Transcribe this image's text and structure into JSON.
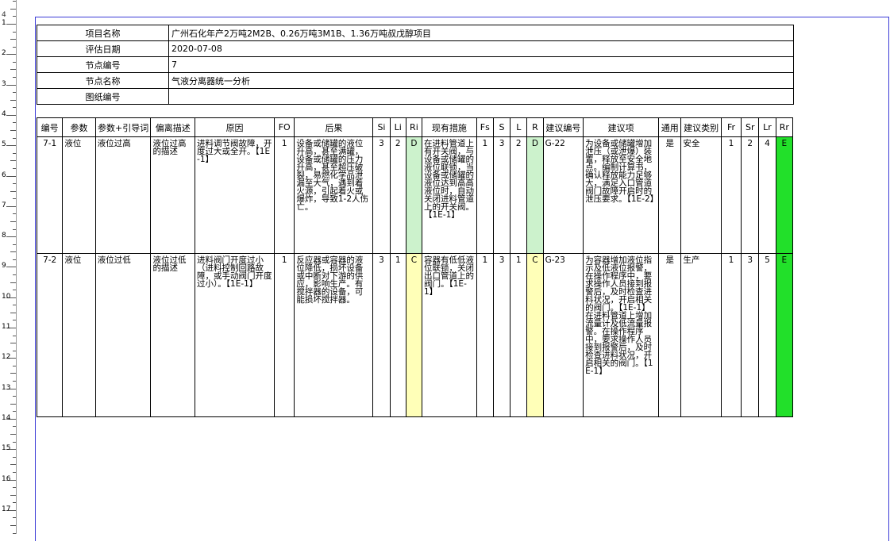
{
  "ruler": {
    "top_marker": "4",
    "numbers": [
      "1",
      "2",
      "3",
      "4",
      "5",
      "6",
      "7",
      "8",
      "9",
      "10",
      "11",
      "12",
      "13",
      "14",
      "15",
      "16",
      "17"
    ]
  },
  "info": [
    {
      "label": "项目名称",
      "value": "广州石化年产2万吨2M2B、0.26万吨3M1B、1.36万吨叔戊醇项目"
    },
    {
      "label": "评估日期",
      "value": "2020-07-08"
    },
    {
      "label": "节点编号",
      "value": "7"
    },
    {
      "label": "节点名称",
      "value": "气液分离器统一分析"
    },
    {
      "label": "图纸编号",
      "value": ""
    }
  ],
  "columns": [
    "编号",
    "参数",
    "参数+引导词",
    "偏离描述",
    "原因",
    "FO",
    "后果",
    "Si",
    "Li",
    "Ri",
    "现有措施",
    "Fs",
    "S",
    "L",
    "R",
    "建议编号",
    "建议项",
    "通用",
    "建议类别",
    "Fr",
    "Sr",
    "Lr",
    "Rr"
  ],
  "rows": [
    {
      "id": "7-1",
      "param": "液位",
      "guide": "液位过高",
      "deviation": "液位过高的描述",
      "cause": "进料调节阀故障，开度过大或全开。【1E-1】",
      "fo": "1",
      "consequence": "设备或储罐的液位升高，甚至满罐，设备或储罐的压力升高，甚至超压破裂，易燃化学品泄漏至大气，遇到着火源，引起着火或爆炸，导致1-2人伤亡。",
      "si": "3",
      "li": "2",
      "ri": "D",
      "measures": "在进料管道上有开关阀，与设备或储罐的液位联锁，当设备或储罐的液位达到高高液位时，自动关闭进料管道上的开关阀。【1E-1】",
      "fs": "1",
      "s": "3",
      "l": "2",
      "r": "D",
      "rec_id": "G-22",
      "recommendation": "为设备或储罐增加泄压（或泄爆）装置，释放至安全地点。编制计算书，确认释放能力足够大，满足入口管道阀门故障开启时的泄压要求。【1E-2】",
      "general": "是",
      "category": "安全",
      "fr": "1",
      "sr": "2",
      "lr": "4",
      "rr": "E"
    },
    {
      "id": "7-2",
      "param": "液位",
      "guide": "液位过低",
      "deviation": "液位过低的描述",
      "cause": "进料阀门开度过小（进料控制回路故障，或手动阀门开度过小）。【1E-1】",
      "fo": "1",
      "consequence": "反应器或容器的液位降低，损坏设备或中断对下游的供应，影响生产。有搅拌器的设备，可能损坏搅拌器。",
      "si": "3",
      "li": "1",
      "ri": "C",
      "measures": "容器有低低液位联锁，关闭出口管道上的阀门。【1E-1】",
      "fs": "1",
      "s": "3",
      "l": "1",
      "r": "C",
      "rec_id": "G-23",
      "recommendation": "为容器增加液位指示及低液位报警，在操作程序中，要求操作人员接到报警后，及时检查进料状况，开启相关的阀门。【1E-1】在进料管道上增加流量计及低流量报警。在操作程序中，要求操作人员接到报警后，及时检查进料状况，开启相关的阀门。【1E-1】",
      "general": "是",
      "category": "生产",
      "fr": "1",
      "sr": "3",
      "lr": "5",
      "rr": "E"
    }
  ],
  "colors": {
    "frame": "#3b3bd6",
    "ri_d": "#ccf2cc",
    "ri_c": "#ffffb8",
    "rr_e": "#22e02a"
  }
}
